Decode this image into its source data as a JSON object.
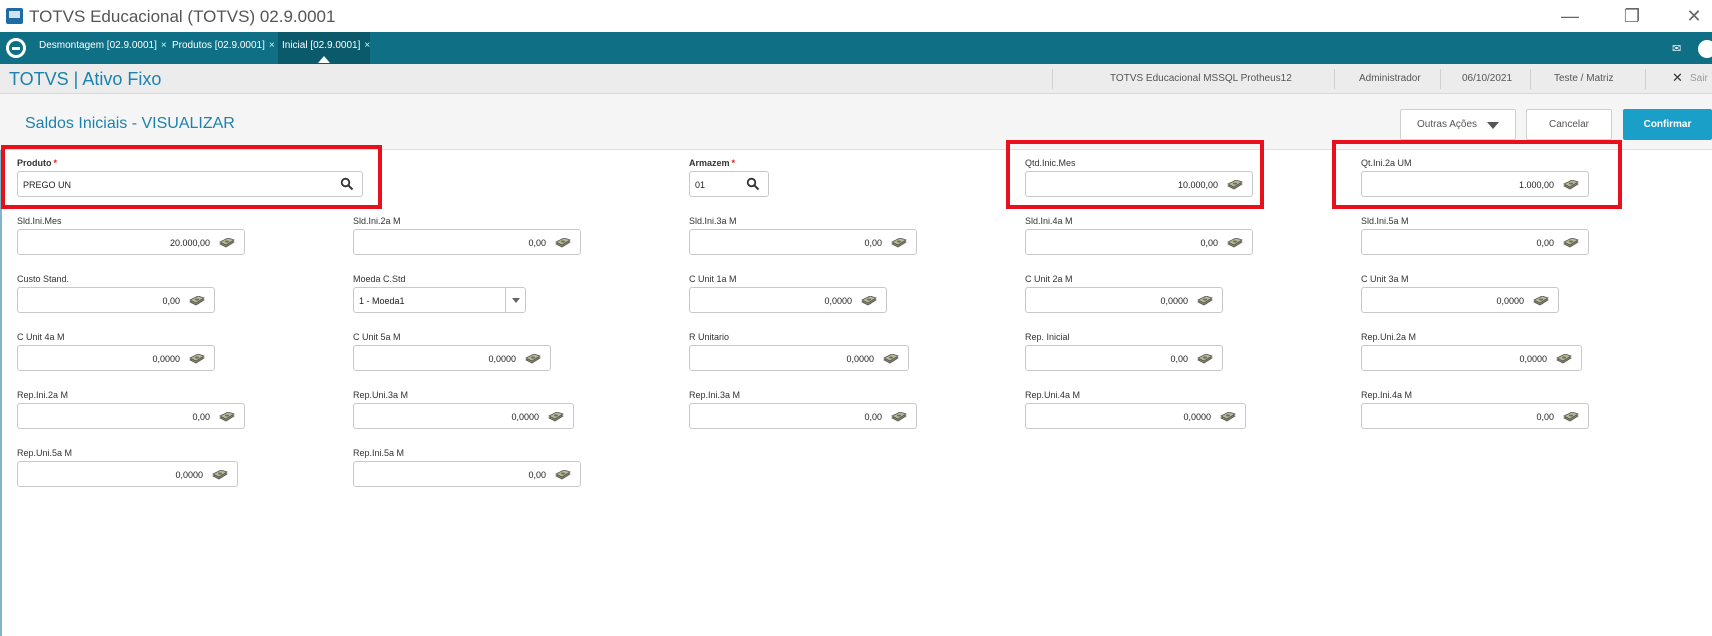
{
  "window": {
    "title": "TOTVS Educacional (TOTVS) 02.9.0001"
  },
  "tabs": [
    {
      "label": "Desmontagem [02.9.0001]",
      "close": "×"
    },
    {
      "label": "Produtos [02.9.0001]",
      "close": "×"
    },
    {
      "label": "Inicial [02.9.0001]",
      "close": "×"
    }
  ],
  "header": {
    "app_title": "TOTVS | Ativo Fixo",
    "environment": "TOTVS Educacional MSSQL Protheus12",
    "user": "Administrador",
    "date": "06/10/2021",
    "branch": "Teste / Matriz",
    "exit_label": "Sair",
    "exit_icon": "close-icon"
  },
  "page": {
    "title": "Saldos Iniciais - VISUALIZAR",
    "other_actions_label": "Outras Ações",
    "cancel_label": "Cancelar",
    "confirm_label": "Confirmar"
  },
  "colors": {
    "accent": "#1b83ad",
    "tabbar": "#0f6f85",
    "primary_button": "#1aa0c8",
    "highlight": "#e8101b"
  },
  "fields": {
    "produto": {
      "label": "Produto",
      "value": "PREGO UN"
    },
    "armazem": {
      "label": "Armazem",
      "value": "01"
    },
    "qtd_inic_mes": {
      "label": "Qtd.Inic.Mes",
      "value": "10.000,00"
    },
    "qt_ini_2a_um": {
      "label": "Qt.Ini.2a UM",
      "value": "1.000,00"
    },
    "sld_ini_mes": {
      "label": "Sld.Ini.Mes",
      "value": "20.000,00"
    },
    "sld_ini_2a_m": {
      "label": "Sld.Ini.2a M",
      "value": "0,00"
    },
    "sld_ini_3a_m": {
      "label": "Sld.Ini.3a M",
      "value": "0,00"
    },
    "sld_ini_4a_m": {
      "label": "Sld.Ini.4a M",
      "value": "0,00"
    },
    "sld_ini_5a_m": {
      "label": "Sld.Ini.5a M",
      "value": "0,00"
    },
    "custo_stand": {
      "label": "Custo Stand.",
      "value": "0,00"
    },
    "moeda_c_std": {
      "label": "Moeda C.Std",
      "value": "1 - Moeda1"
    },
    "c_unit_1a_m": {
      "label": "C Unit 1a M",
      "value": "0,0000"
    },
    "c_unit_2a_m": {
      "label": "C Unit 2a M",
      "value": "0,0000"
    },
    "c_unit_3a_m": {
      "label": "C Unit 3a M",
      "value": "0,0000"
    },
    "c_unit_4a_m": {
      "label": "C Unit 4a M",
      "value": "0,0000"
    },
    "c_unit_5a_m": {
      "label": "C Unit 5a M",
      "value": "0,0000"
    },
    "r_unitario": {
      "label": "R Unitario",
      "value": "0,0000"
    },
    "rep_inicial": {
      "label": "Rep. Inicial",
      "value": "0,00"
    },
    "rep_uni_2a_m": {
      "label": "Rep.Uni.2a M",
      "value": "0,0000"
    },
    "rep_ini_2a_m": {
      "label": "Rep.Ini.2a M",
      "value": "0,00"
    },
    "rep_uni_3a_m": {
      "label": "Rep.Uni.3a M",
      "value": "0,0000"
    },
    "rep_ini_3a_m": {
      "label": "Rep.Ini.3a M",
      "value": "0,00"
    },
    "rep_uni_4a_m": {
      "label": "Rep.Uni.4a M",
      "value": "0,0000"
    },
    "rep_ini_4a_m": {
      "label": "Rep.Ini.4a M",
      "value": "0,00"
    },
    "rep_uni_5a_m": {
      "label": "Rep.Uni.5a M",
      "value": "0,0000"
    },
    "rep_ini_5a_m": {
      "label": "Rep.Ini.5a M",
      "value": "0,00"
    }
  }
}
